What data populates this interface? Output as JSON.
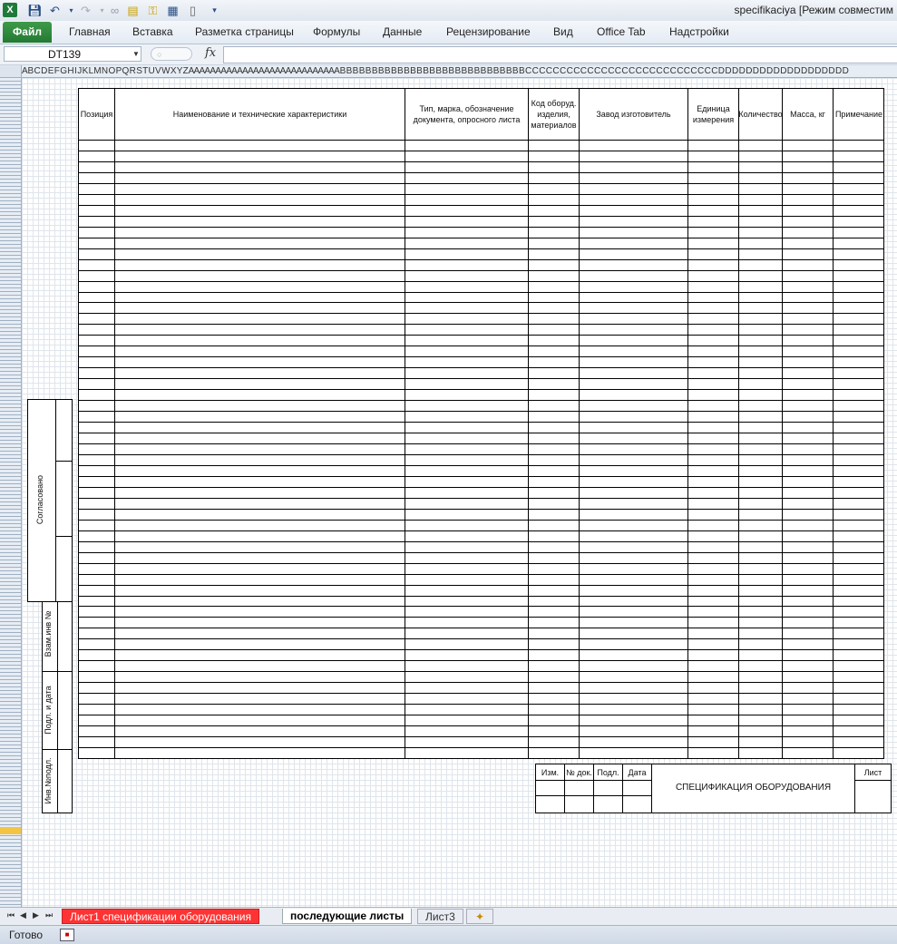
{
  "window": {
    "title": "specifikaciya  [Режим совместим"
  },
  "quick_access": {
    "app_icon": "excel-icon",
    "items": [
      "save-icon",
      "undo-icon",
      "redo-icon",
      "link-icon",
      "print-preview-icon",
      "key-icon",
      "table-icon",
      "new-doc-icon",
      "customize-icon"
    ]
  },
  "ribbon": {
    "file_tab": "Файл",
    "tabs": [
      "Главная",
      "Вставка",
      "Разметка страницы",
      "Формулы",
      "Данные",
      "Рецензирование",
      "Вид",
      "Office Tab",
      "Надстройки"
    ]
  },
  "formula_bar": {
    "name_box": "DT139",
    "fx": "fx",
    "formula": ""
  },
  "column_header_letters": "A B C D E F G H I  J  K L M N O P Q R S T U V W X Y Z A A A A A A A A A A A A A A A A A A A A A A A A A A A A B B B B B B B B B B B B B B B B B B B B B B B B B B B B B C C C C C C C C C C C C C C C C C C C C C C C C C C C C D D D D D D D D D D D D D D D D D D D",
  "spec_table": {
    "headers": [
      "Позиция",
      "Наименование и технические характеристики",
      "Тип, марка, обозначение документа, опросного листа",
      "Код оборуд. изделия, материалов",
      "Завод изготовитель",
      "Единица измерения",
      "Количество",
      "Масса, кг",
      "Примечание"
    ],
    "row_count": 57
  },
  "side_stamp": {
    "agreed": "Согласовано",
    "vzam_inv": "Взам.инв №",
    "podp_data": "Подл. и дата",
    "inv_podl": "Инв.№подл."
  },
  "title_block": {
    "cols": [
      "Изм.",
      "№ док.",
      "Подл.",
      "Дата"
    ],
    "title": "СПЕЦИФИКАЦИЯ ОБОРУДОВАНИЯ",
    "sheet": "Лист"
  },
  "sheet_tabs": {
    "tabs": [
      "Лист1 спецификации оборудования",
      "последующие листы",
      "Лист3"
    ],
    "active_index": 1
  },
  "status": {
    "ready": "Готово"
  }
}
